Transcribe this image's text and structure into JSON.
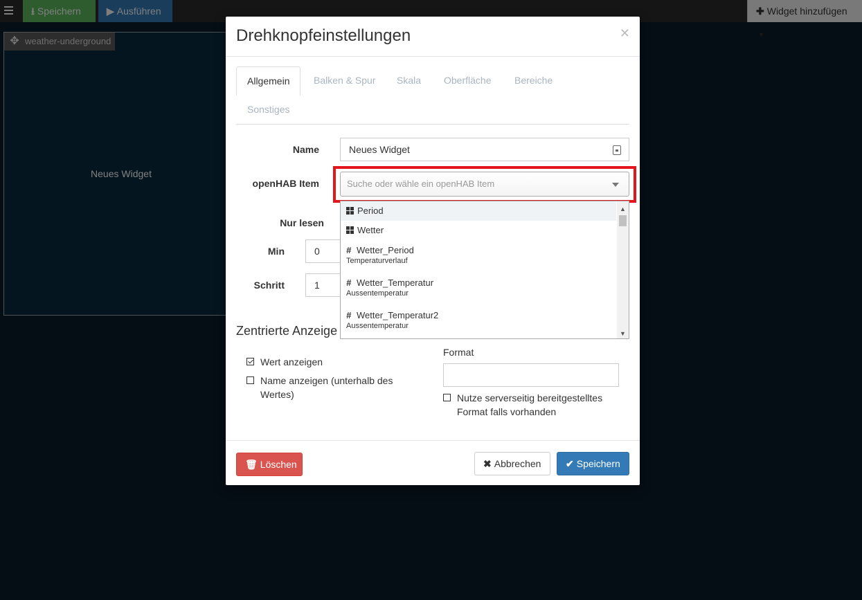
{
  "toolbar": {
    "save_label": "Speichern",
    "run_label": "Ausführen",
    "add_widget_label": "Widget hinzufügen"
  },
  "canvas": {
    "widget_header": "weather-underground",
    "widget_text": "Neues Widget"
  },
  "modal": {
    "title": "Drehknopfeinstellungen",
    "tabs": [
      "Allgemein",
      "Balken & Spur",
      "Skala",
      "Oberfläche",
      "Bereiche",
      "Sonstiges"
    ],
    "active_tab": "Allgemein",
    "fields": {
      "name_label": "Name",
      "name_value": "Neues Widget",
      "item_label": "openHAB Item",
      "item_placeholder": "Suche oder wähle ein openHAB Item",
      "readonly_label": "Nur lesen",
      "min_label": "Min",
      "min_value": "0",
      "step_label": "Schritt",
      "step_value": "1"
    },
    "dropdown_items": [
      {
        "icon": "group-icon",
        "name": "Period",
        "sub": ""
      },
      {
        "icon": "group-icon",
        "name": "Wetter",
        "sub": ""
      },
      {
        "icon": "number-icon",
        "name": "Wetter_Period",
        "sub": "Temperaturverlauf"
      },
      {
        "icon": "number-icon",
        "name": "Wetter_Temperatur",
        "sub": "Aussentemperatur"
      },
      {
        "icon": "number-icon",
        "name": "Wetter_Temperatur2",
        "sub": "Aussentemperatur"
      }
    ],
    "centered": {
      "title": "Zentrierte Anzeige",
      "show_value_label": "Wert anzeigen",
      "show_value_checked": true,
      "show_name_label": "Name anzeigen (unterhalb des Wertes)",
      "show_name_checked": false,
      "format_label": "Format",
      "format_value": "",
      "server_format_label": "Nutze serverseitig bereitgestelltes Format falls vorhanden",
      "server_format_checked": false
    },
    "footer": {
      "delete_label": "Löschen",
      "cancel_label": "Abbrechen",
      "save_label": "Speichern"
    }
  },
  "colors": {
    "danger": "#d9534f",
    "primary": "#337ab7",
    "success": "#5cb85c",
    "highlight": "#e3161e"
  }
}
